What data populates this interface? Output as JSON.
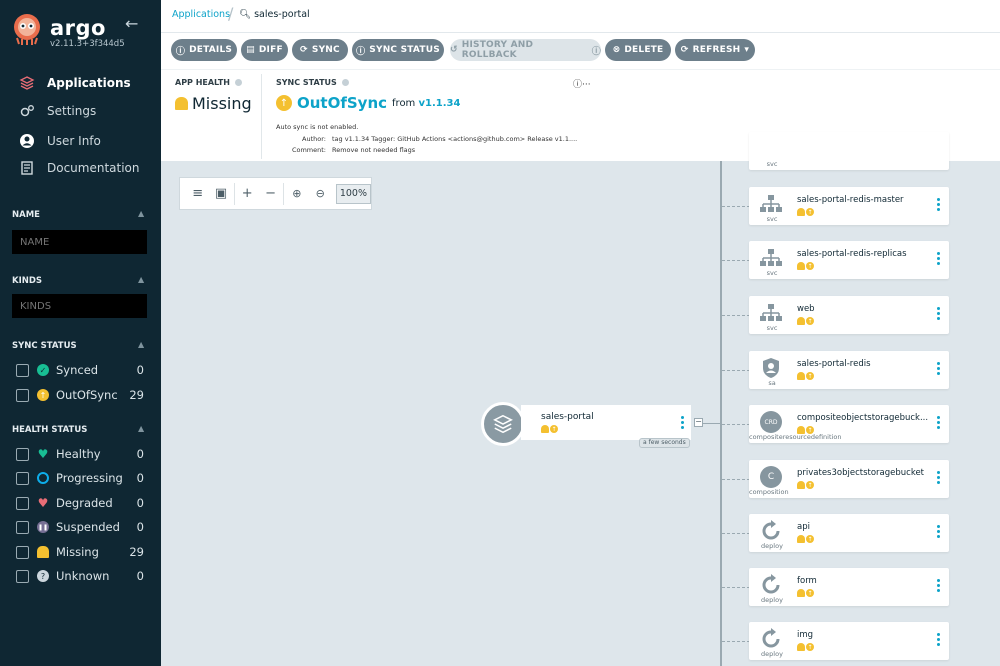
{
  "sidebar": {
    "brand": "argo",
    "version": "v2.11.3+3f344d5",
    "nav": [
      {
        "label": "Applications",
        "icon": "layers-icon"
      },
      {
        "label": "Settings",
        "icon": "gear-icon"
      },
      {
        "label": "User Info",
        "icon": "user-icon"
      },
      {
        "label": "Documentation",
        "icon": "document-icon"
      }
    ],
    "filters": {
      "name": {
        "title": "NAME",
        "placeholder": "NAME"
      },
      "kinds": {
        "title": "KINDS",
        "placeholder": "KINDS"
      },
      "sync_status": {
        "title": "SYNC STATUS",
        "items": [
          {
            "label": "Synced",
            "count": "0",
            "color": "#18be94"
          },
          {
            "label": "OutOfSync",
            "count": "29",
            "color": "#f4c030"
          }
        ]
      },
      "health_status": {
        "title": "HEALTH STATUS",
        "items": [
          {
            "label": "Healthy",
            "count": "0",
            "color": "#18be94"
          },
          {
            "label": "Progressing",
            "count": "0",
            "color": "#0dadea"
          },
          {
            "label": "Degraded",
            "count": "0",
            "color": "#e96d76"
          },
          {
            "label": "Suspended",
            "count": "0",
            "color": "#766f94"
          },
          {
            "label": "Missing",
            "count": "29",
            "color": "#f4c030"
          },
          {
            "label": "Unknown",
            "count": "0",
            "color": "#ccd6dd"
          }
        ]
      }
    }
  },
  "breadcrumb": {
    "root": "Applications",
    "current": "sales-portal"
  },
  "toolbar": {
    "details": "DETAILS",
    "diff": "DIFF",
    "sync": "SYNC",
    "sync_status": "SYNC STATUS",
    "history": "HISTORY AND ROLLBACK",
    "delete": "DELETE",
    "refresh": "REFRESH"
  },
  "status": {
    "app_health_title": "APP HEALTH",
    "app_health": "Missing",
    "sync_status_title": "SYNC STATUS",
    "sync_status": "OutOfSync",
    "from": "from",
    "revision": "v1.1.34",
    "auto_sync": "Auto sync is not enabled.",
    "author_label": "Author:",
    "author": "tag v1.1.34 Tagger: GitHub Actions <actions@github.com> Release v1.1....",
    "comment_label": "Comment:",
    "comment": "Remove not needed flags"
  },
  "zoom": {
    "level": "100%"
  },
  "root_node": {
    "name": "sales-portal",
    "age": "a few seconds"
  },
  "nodes": [
    {
      "name": "",
      "kind": "svc",
      "type": "svc"
    },
    {
      "name": "sales-portal-redis-master",
      "kind": "svc",
      "type": "svc"
    },
    {
      "name": "sales-portal-redis-replicas",
      "kind": "svc",
      "type": "svc"
    },
    {
      "name": "web",
      "kind": "svc",
      "type": "svc"
    },
    {
      "name": "sales-portal-redis",
      "kind": "sa",
      "type": "sa"
    },
    {
      "name": "compositeobjectstoragebuck...",
      "kind": "compositeresourcedefinition",
      "type": "crd",
      "glyph": "CRD"
    },
    {
      "name": "privates3objectstoragebucket",
      "kind": "composition",
      "type": "comp",
      "glyph": "C"
    },
    {
      "name": "api",
      "kind": "deploy",
      "type": "deploy"
    },
    {
      "name": "form",
      "kind": "deploy",
      "type": "deploy"
    },
    {
      "name": "img",
      "kind": "deploy",
      "type": "deploy"
    }
  ]
}
